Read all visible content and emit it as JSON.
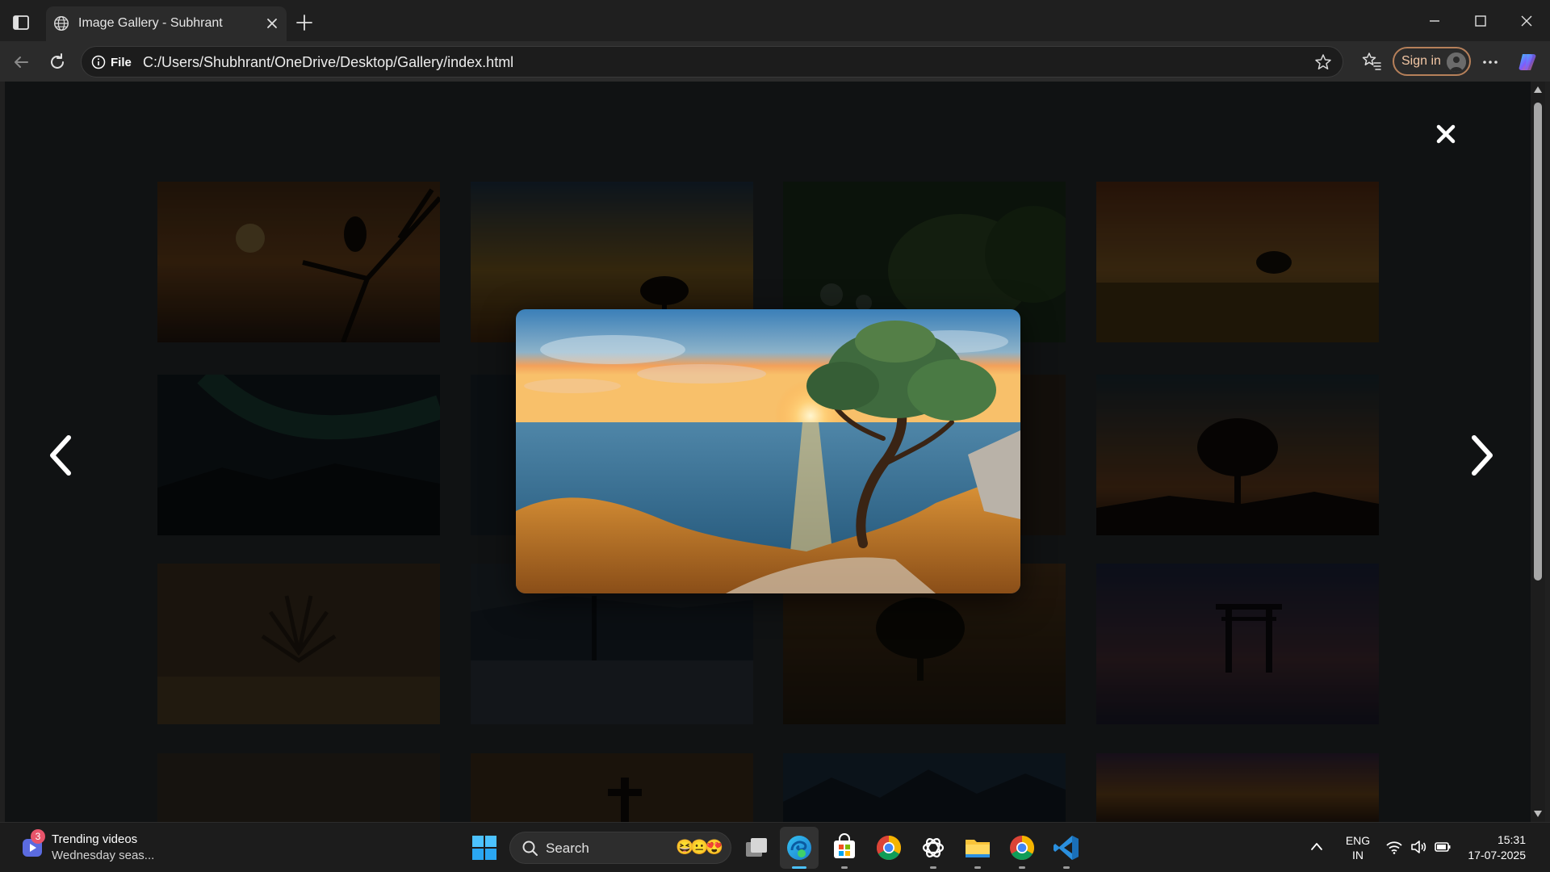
{
  "browser": {
    "tab_title": "Image Gallery - Subhrant",
    "address_chip": "File",
    "url": "C:/Users/Shubhrant/OneDrive/Desktop/Gallery/index.html",
    "signin_label": "Sign in"
  },
  "gallery": {
    "lightbox_image": "tree-sunset-sea",
    "thumbnails": [
      "bird-on-branch-sunset",
      "tree-silhouette-golden-sky",
      "green-leaves-bokeh",
      "lone-tree-field-sunset",
      "aurora-mountains",
      "unknown-thumbnail",
      "unknown-thumbnail",
      "tree-silhouette-dusk",
      "spiky-plant-desert",
      "tree-reflection-lake",
      "lone-tree-hill",
      "torii-gate-lake",
      "mountain-sunset",
      "cross-silhouette",
      "mountain-range-blue",
      "orange-horizon"
    ],
    "close_icon": "close-icon",
    "prev_icon": "chevron-left-icon",
    "next_icon": "chevron-right-icon"
  },
  "taskbar": {
    "news_badge": "3",
    "news_title": "Trending videos",
    "news_subtitle": "Wednesday seas...",
    "search_label": "Search",
    "search_emojis": "😆😐😍",
    "lang_top": "ENG",
    "lang_bottom": "IN",
    "time": "15:31",
    "date": "17-07-2025"
  },
  "colors": {
    "page_bg": "#111315",
    "accent": "#4cc2ff",
    "signin_border": "#b6805a"
  }
}
